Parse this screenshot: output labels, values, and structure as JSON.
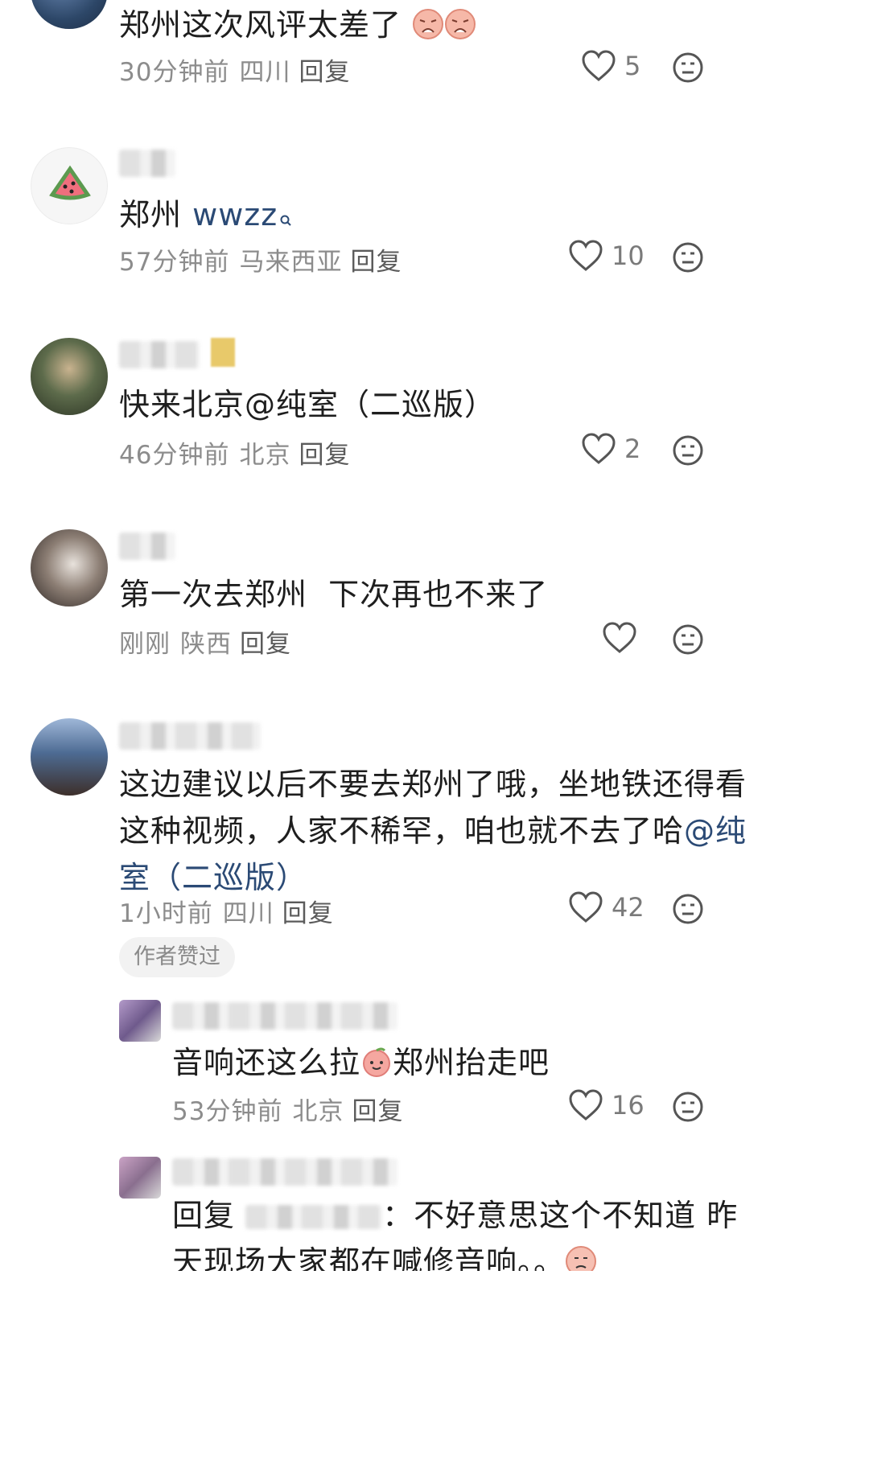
{
  "comments": [
    {
      "text": "郑州这次风评太差了",
      "emoji_count": 2,
      "time": "30分钟前",
      "location": "四川",
      "reply_label": "回复",
      "likes": "5"
    },
    {
      "text": "郑州",
      "search_term": "wwzz",
      "time": "57分钟前",
      "location": "马来西亚",
      "reply_label": "回复",
      "likes": "10"
    },
    {
      "text": "快来北京@纯室（二巡版）",
      "time": "46分钟前",
      "location": "北京",
      "reply_label": "回复",
      "likes": "2"
    },
    {
      "text": "第一次去郑州  下次再也不来了",
      "time": "刚刚",
      "location": "陕西",
      "reply_label": "回复",
      "likes": ""
    },
    {
      "text_line1": "这边建议以后不要去郑州了哦，坐地铁还得看",
      "text_line2_a": "这种视频，人家不稀罕，咱也就不去了哈",
      "mention_line2": "@纯",
      "mention_line3": "室（二巡版）",
      "time": "1小时前",
      "location": "四川",
      "reply_label": "回复",
      "likes": "42",
      "author_badge": "作者赞过"
    }
  ],
  "replies": [
    {
      "text_a": "音响还这么拉",
      "text_b": "郑州抬走吧",
      "time": "53分钟前",
      "location": "北京",
      "reply_label": "回复",
      "likes": "16"
    },
    {
      "prefix": "回复",
      "text": "：不好意思这个不知道 昨",
      "text_line2": "天现场大家都在喊修音响。。"
    }
  ],
  "colors": {
    "link": "#2b4a75",
    "meta": "#8c8c8c",
    "icon": "#555555"
  }
}
